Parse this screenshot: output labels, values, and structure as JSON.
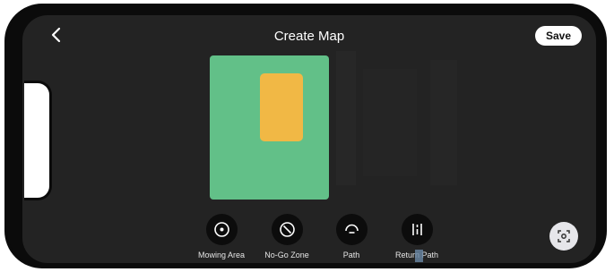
{
  "header": {
    "title": "Create Map",
    "save_label": "Save",
    "back_icon": "chevron-left-icon"
  },
  "map": {
    "mowing_area_color": "#62c088",
    "no_go_zone_color": "#f1b845",
    "background_color": "#232323"
  },
  "toolbar": {
    "items": [
      {
        "label": "Mowing Area",
        "icon": "target-circle-icon"
      },
      {
        "label": "No-Go Zone",
        "icon": "no-entry-icon"
      },
      {
        "label": "Path",
        "icon": "path-icon"
      },
      {
        "label": "Return Path",
        "icon": "return-path-icon"
      }
    ]
  },
  "locate": {
    "icon": "locate-icon"
  }
}
